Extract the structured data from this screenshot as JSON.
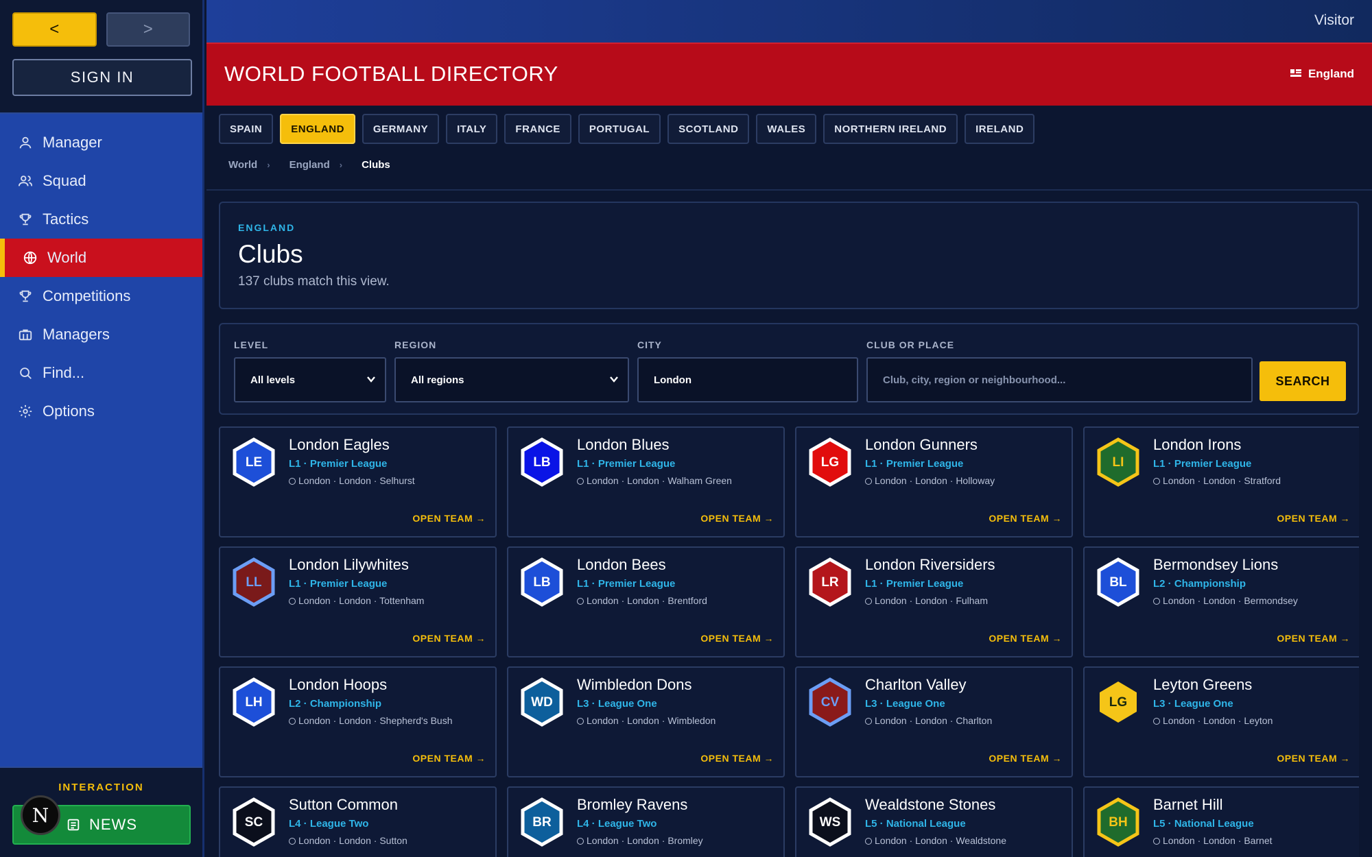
{
  "nav": {
    "back": "<",
    "forward": ">"
  },
  "sidebar": {
    "sign_in": "SIGN IN",
    "items": [
      {
        "label": "Manager",
        "icon": "user-icon"
      },
      {
        "label": "Squad",
        "icon": "users-icon"
      },
      {
        "label": "Tactics",
        "icon": "trophy-icon"
      },
      {
        "label": "World",
        "icon": "globe-icon",
        "active": true
      },
      {
        "label": "Competitions",
        "icon": "trophy-icon"
      },
      {
        "label": "Managers",
        "icon": "briefcase-icon"
      },
      {
        "label": "Find...",
        "icon": "search-icon"
      },
      {
        "label": "Options",
        "icon": "gear-icon"
      }
    ],
    "interaction_label": "INTERACTION",
    "news_label": "NEWS",
    "logo_letter": "N"
  },
  "topbar": {
    "visitor": "Visitor"
  },
  "header": {
    "title": "WORLD FOOTBALL DIRECTORY",
    "country": "England"
  },
  "tabs": [
    "SPAIN",
    "ENGLAND",
    "GERMANY",
    "ITALY",
    "FRANCE",
    "PORTUGAL",
    "SCOTLAND",
    "WALES",
    "NORTHERN IRELAND",
    "IRELAND"
  ],
  "active_tab": "ENGLAND",
  "breadcrumb": [
    "World",
    "England",
    "Clubs"
  ],
  "page": {
    "eyebrow": "ENGLAND",
    "title": "Clubs",
    "count_text": "137 clubs match this view."
  },
  "filters": {
    "level_label": "LEVEL",
    "level_value": "All levels",
    "region_label": "REGION",
    "region_value": "All regions",
    "city_label": "CITY",
    "city_value": "London",
    "query_label": "CLUB OR PLACE",
    "query_placeholder": "Club, city, region or neighbourhood...",
    "search_button": "SEARCH"
  },
  "open_team_label": "OPEN TEAM →",
  "clubs": [
    {
      "name": "London Eagles",
      "code": "LE",
      "league": "L1 · Premier League",
      "location": "London · London · Selhurst",
      "fill": "#1d4fd8",
      "border": "#ffffff",
      "text": "#ffffff"
    },
    {
      "name": "London Blues",
      "code": "LB",
      "league": "L1 · Premier League",
      "location": "London · London · Walham Green",
      "fill": "#0a14e6",
      "border": "#ffffff",
      "text": "#ffffff"
    },
    {
      "name": "London Gunners",
      "code": "LG",
      "league": "L1 · Premier League",
      "location": "London · London · Holloway",
      "fill": "#e10d0d",
      "border": "#ffffff",
      "text": "#ffffff"
    },
    {
      "name": "London Irons",
      "code": "LI",
      "league": "L1 · Premier League",
      "location": "London · London · Stratford",
      "fill": "#1f6b2c",
      "border": "#f5c518",
      "text": "#f5c518"
    },
    {
      "name": "London Lilywhites",
      "code": "LL",
      "league": "L1 · Premier League",
      "location": "London · London · Tottenham",
      "fill": "#7a1a1a",
      "border": "#6c9ef5",
      "text": "#6c9ef5"
    },
    {
      "name": "London Bees",
      "code": "LB",
      "league": "L1 · Premier League",
      "location": "London · London · Brentford",
      "fill": "#1d4fd8",
      "border": "#ffffff",
      "text": "#ffffff"
    },
    {
      "name": "London Riversiders",
      "code": "LR",
      "league": "L1 · Premier League",
      "location": "London · London · Fulham",
      "fill": "#b4161b",
      "border": "#ffffff",
      "text": "#ffffff"
    },
    {
      "name": "Bermondsey Lions",
      "code": "BL",
      "league": "L2 · Championship",
      "location": "London · London · Bermondsey",
      "fill": "#1d4fd8",
      "border": "#ffffff",
      "text": "#ffffff"
    },
    {
      "name": "London Hoops",
      "code": "LH",
      "league": "L2 · Championship",
      "location": "London · London · Shepherd's Bush",
      "fill": "#1d4fd8",
      "border": "#ffffff",
      "text": "#ffffff"
    },
    {
      "name": "Wimbledon Dons",
      "code": "WD",
      "league": "L3 · League One",
      "location": "London · London · Wimbledon",
      "fill": "#0d5f9c",
      "border": "#ffffff",
      "text": "#ffffff"
    },
    {
      "name": "Charlton Valley",
      "code": "CV",
      "league": "L3 · League One",
      "location": "London · London · Charlton",
      "fill": "#8a1a1a",
      "border": "#6c9ef5",
      "text": "#6c9ef5"
    },
    {
      "name": "Leyton Greens",
      "code": "LG",
      "league": "L3 · League One",
      "location": "London · London · Leyton",
      "fill": "#f5c518",
      "border": "#f5c518",
      "text": "#1a2a10"
    },
    {
      "name": "Sutton Common",
      "code": "SC",
      "league": "L4 · League Two",
      "location": "London · London · Sutton",
      "fill": "#0b0f1c",
      "border": "#ffffff",
      "text": "#ffffff"
    },
    {
      "name": "Bromley Ravens",
      "code": "BR",
      "league": "L4 · League Two",
      "location": "London · London · Bromley",
      "fill": "#0d5f9c",
      "border": "#ffffff",
      "text": "#ffffff"
    },
    {
      "name": "Wealdstone Stones",
      "code": "WS",
      "league": "L5 · National League",
      "location": "London · London · Wealdstone",
      "fill": "#0b0f1c",
      "border": "#ffffff",
      "text": "#ffffff"
    },
    {
      "name": "Barnet Hill",
      "code": "BH",
      "league": "L5 · National League",
      "location": "London · London · Barnet",
      "fill": "#1f6b2c",
      "border": "#f5c518",
      "text": "#f5c518"
    }
  ]
}
